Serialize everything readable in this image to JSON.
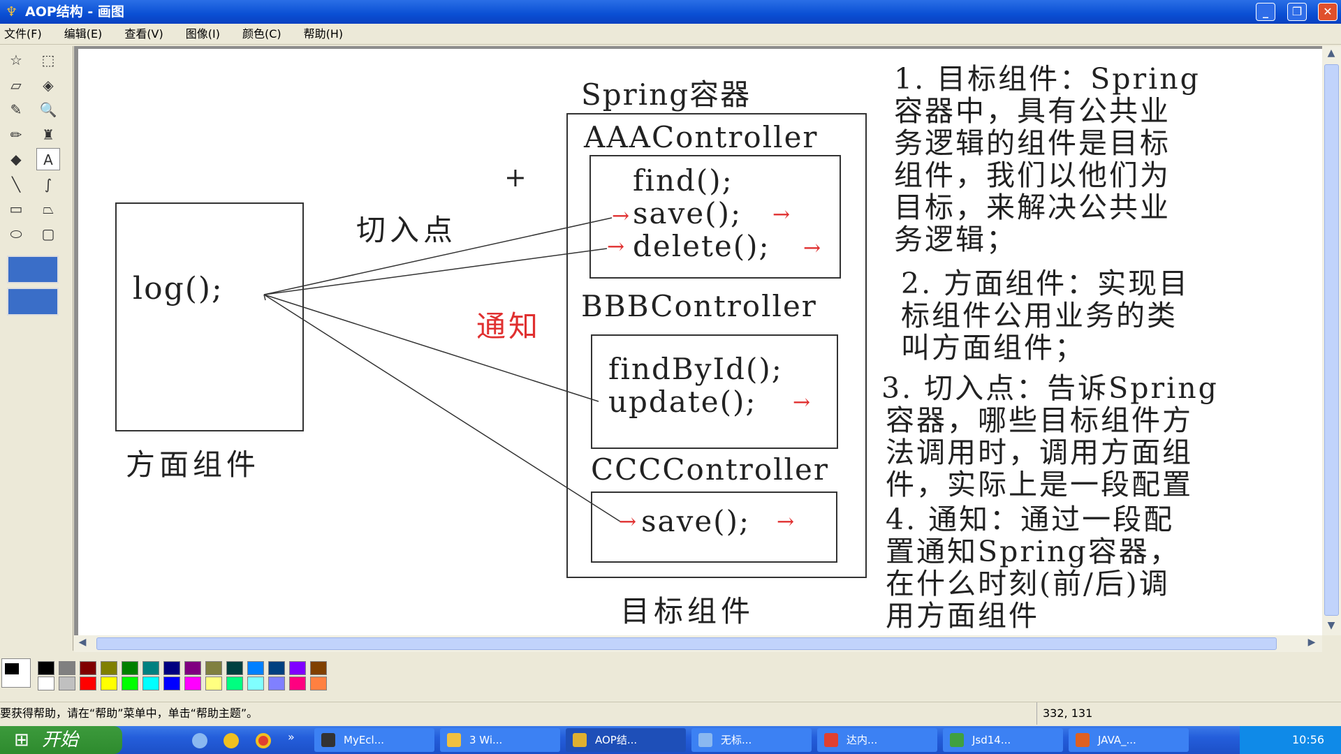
{
  "window": {
    "title": "AOP结构 - 画图",
    "min": "_",
    "max": "❐",
    "close": "✕"
  },
  "menu": [
    "文件(F)",
    "编辑(E)",
    "查看(V)",
    "图像(I)",
    "颜色(C)",
    "帮助(H)"
  ],
  "tools": [
    "free-select",
    "select",
    "eraser",
    "fill",
    "color-picker",
    "magnifier",
    "pencil",
    "brush",
    "airbrush",
    "text",
    "line",
    "curve",
    "rectangle",
    "polygon",
    "ellipse",
    "rounded-rectangle"
  ],
  "tool_glyphs": [
    "☆",
    "⬚",
    "▱",
    "◈",
    "✎",
    "🔍",
    "✏",
    "♜",
    "◆",
    "A",
    "╲",
    "∫",
    "▭",
    "⏢",
    "⬭",
    "▢"
  ],
  "diagram": {
    "container_title": "Spring容器",
    "aspect_method": "log();",
    "aspect_label": "方面组件",
    "pointcut_label": "切入点",
    "advice_label": "通知",
    "target_label": "目标组件",
    "controllers": [
      {
        "name": "AAAController",
        "methods": [
          "find();",
          "save();",
          "delete();"
        ]
      },
      {
        "name": "BBBController",
        "methods": [
          "findById();",
          "update();"
        ]
      },
      {
        "name": "CCCController",
        "methods": [
          "save();"
        ]
      }
    ],
    "cursor": "+",
    "arrow": "→"
  },
  "notes": [
    "1. 目标组件：Spring",
    "容器中，具有公共业",
    "务逻辑的组件是目标",
    "组件，我们以他们为",
    "目标，来解决公共业",
    "务逻辑；",
    "2. 方面组件：实现目",
    "标组件公用业务的类",
    "叫方面组件；",
    "3. 切入点：告诉Spring",
    "容器，哪些目标组件方",
    "法调用时，调用方面组",
    "件，实际上是一段配置",
    "4. 通知：通过一段配",
    "置通知Spring容器，",
    "在什么时刻(前/后)调",
    "用方面组件"
  ],
  "colors": {
    "advice": "#e03030",
    "titlebar": "#0a4fd4"
  },
  "palette": {
    "top": [
      "#000000",
      "#808080",
      "#800000",
      "#808000",
      "#008000",
      "#008080",
      "#000080",
      "#800080",
      "#808040",
      "#004040",
      "#0080ff",
      "#004080",
      "#8000ff",
      "#804000"
    ],
    "bottom": [
      "#ffffff",
      "#c0c0c0",
      "#ff0000",
      "#ffff00",
      "#00ff00",
      "#00ffff",
      "#0000ff",
      "#ff00ff",
      "#ffff80",
      "#00ff80",
      "#80ffff",
      "#8080ff",
      "#ff0080",
      "#ff8040"
    ]
  },
  "status": {
    "help": "要获得帮助，请在“帮助”菜单中，单击“帮助主题”。",
    "coords": "332, 131"
  },
  "taskbar": {
    "start": "开始",
    "more": "»",
    "tasks": [
      "MyEcl...",
      "3 Wi...",
      "AOP结...",
      "无标...",
      "达内...",
      "Jsd14...",
      "JAVA_..."
    ],
    "clock": "10:56"
  }
}
